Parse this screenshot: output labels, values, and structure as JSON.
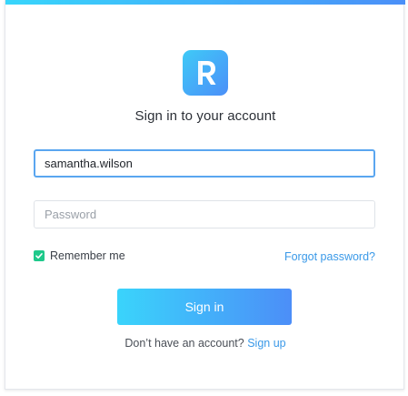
{
  "brand": {
    "logo_icon": "r-logo-icon",
    "accent_start": "#38d6fb",
    "accent_end": "#4b8ff8"
  },
  "form": {
    "title": "Sign in to your account",
    "username_value": "samantha.wilson",
    "password_placeholder": "Password",
    "remember_label": "Remember me",
    "remember_checked": true,
    "forgot_label": "Forgot password?",
    "submit_label": "Sign in",
    "signup_prompt": "Don’t have an account?",
    "signup_link": "Sign up"
  },
  "colors": {
    "link": "#3a99e8",
    "checkbox": "#1fc98b",
    "focus_border": "#5aa6f0"
  }
}
